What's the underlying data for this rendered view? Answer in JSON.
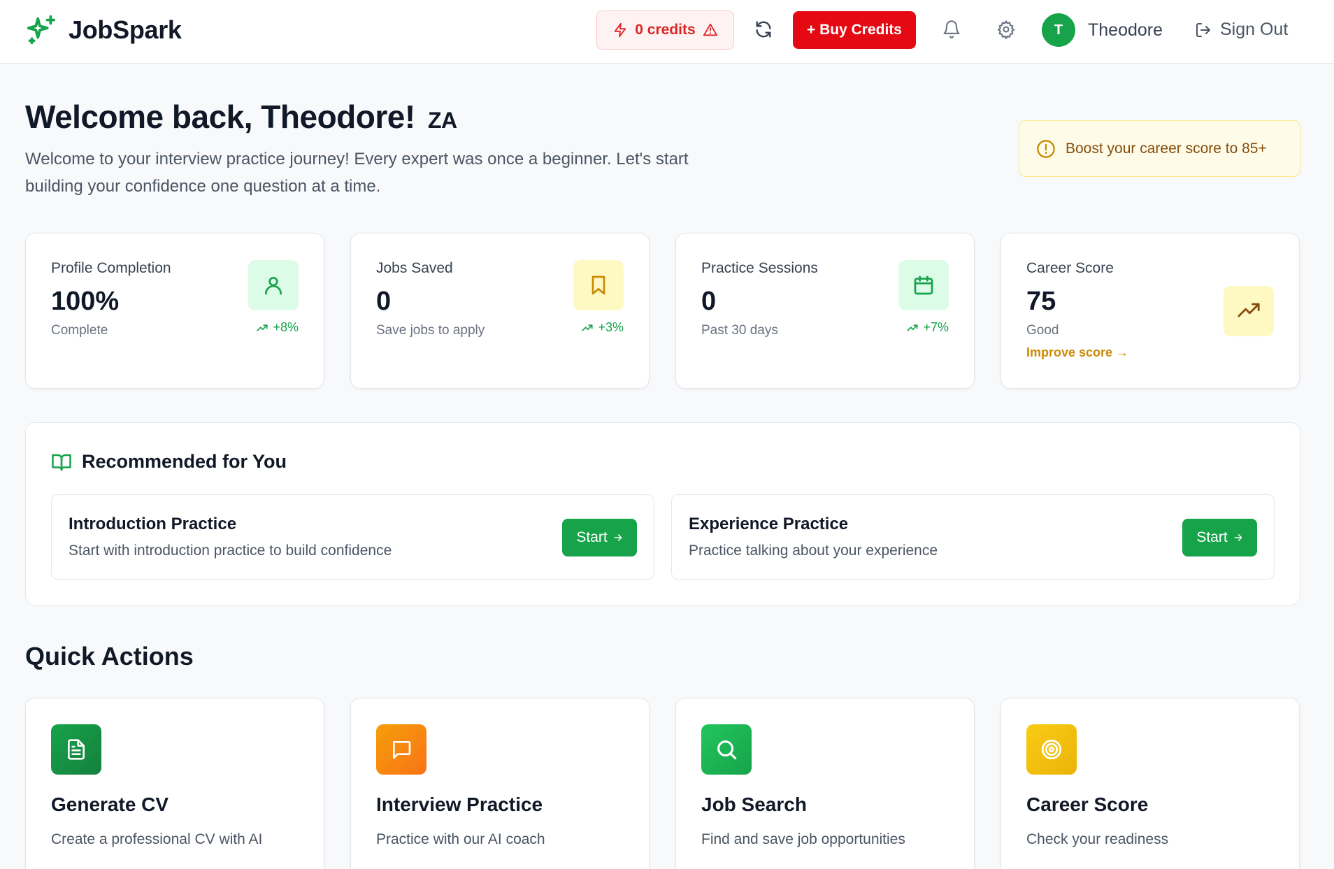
{
  "header": {
    "brand": "JobSpark",
    "credits": "0 credits",
    "buy_label": "+ Buy Credits",
    "avatar_initial": "T",
    "user_name": "Theodore",
    "sign_out": "Sign Out"
  },
  "welcome": {
    "title": "Welcome back, Theodore!",
    "tag": "ZA",
    "subtitle": "Welcome to your interview practice journey! Every expert was once a beginner. Let's start building your confidence one question at a time.",
    "boost": "Boost your career score to 85+"
  },
  "stats": [
    {
      "label": "Profile Completion",
      "value": "100%",
      "note": "Complete",
      "trend": "+8%",
      "icon": "user-icon"
    },
    {
      "label": "Jobs Saved",
      "value": "0",
      "note": "Save jobs to apply",
      "trend": "+3%",
      "icon": "bookmark-icon"
    },
    {
      "label": "Practice Sessions",
      "value": "0",
      "note": "Past 30 days",
      "trend": "+7%",
      "icon": "calendar-icon"
    },
    {
      "label": "Career Score",
      "value": "75",
      "note": "Good",
      "link": "Improve score →",
      "icon": "trending-up-icon"
    }
  ],
  "recommended": {
    "title": "Recommended for You",
    "items": [
      {
        "title": "Introduction Practice",
        "desc": "Start with introduction practice to build confidence",
        "button": "Start"
      },
      {
        "title": "Experience Practice",
        "desc": "Practice talking about your experience",
        "button": "Start"
      }
    ]
  },
  "quick_actions": {
    "title": "Quick Actions",
    "items": [
      {
        "name": "Generate CV",
        "desc": "Create a professional CV with AI",
        "icon": "document-icon"
      },
      {
        "name": "Interview Practice",
        "desc": "Practice with our AI coach",
        "icon": "chat-icon"
      },
      {
        "name": "Job Search",
        "desc": "Find and save job opportunities",
        "icon": "search-icon"
      },
      {
        "name": "Career Score",
        "desc": "Check your readiness",
        "icon": "target-icon"
      }
    ]
  },
  "colors": {
    "brand_green": "#16a34a",
    "danger_red": "#e50914",
    "warning_yellow": "#ca8a04"
  }
}
